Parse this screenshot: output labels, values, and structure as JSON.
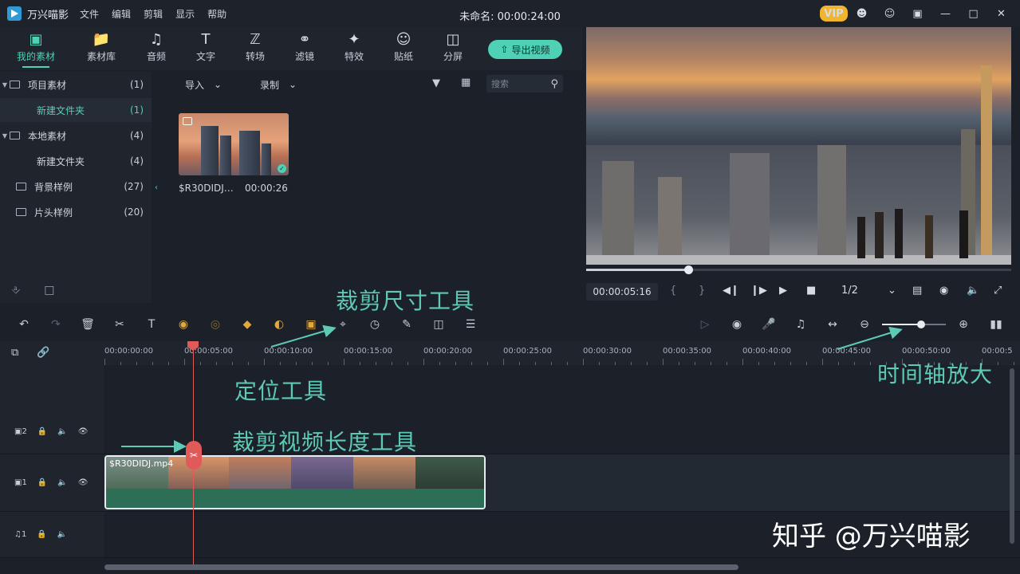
{
  "app": {
    "name": "万兴喵影",
    "menu": [
      "文件",
      "编辑",
      "剪辑",
      "显示",
      "帮助"
    ],
    "doc_title": "未命名: 00:00:24:00",
    "vip": "VIP"
  },
  "tabs": [
    {
      "label": "我的素材",
      "icon": "media-icon"
    },
    {
      "label": "素材库",
      "icon": "folder-icon"
    },
    {
      "label": "音频",
      "icon": "music-icon"
    },
    {
      "label": "文字",
      "icon": "text-icon"
    },
    {
      "label": "转场",
      "icon": "transition-icon"
    },
    {
      "label": "滤镜",
      "icon": "filter-icon"
    },
    {
      "label": "特效",
      "icon": "effects-icon"
    },
    {
      "label": "贴纸",
      "icon": "sticker-icon"
    },
    {
      "label": "分屏",
      "icon": "split-icon"
    }
  ],
  "export_label": "导出视频",
  "tree": [
    {
      "label": "项目素材",
      "count": "(1)"
    },
    {
      "label": "新建文件夹",
      "count": "(1)"
    },
    {
      "label": "本地素材",
      "count": "(4)"
    },
    {
      "label": "新建文件夹",
      "count": "(4)"
    },
    {
      "label": "背景样例",
      "count": "(27)"
    },
    {
      "label": "片头样例",
      "count": "(20)"
    }
  ],
  "media": {
    "import_label": "导入",
    "record_label": "录制",
    "search_placeholder": "搜索",
    "clip_name": "$R30DIDJ…",
    "clip_duration": "00:00:26"
  },
  "preview": {
    "timecode": "00:00:05:16",
    "ratio": "1/2",
    "progress": 0.24
  },
  "ruler": [
    "00:00:00:00",
    "00:00:05:00",
    "00:00:10:00",
    "00:00:15:00",
    "00:00:20:00",
    "00:00:25:00",
    "00:00:30:00",
    "00:00:35:00",
    "00:00:40:00",
    "00:00:45:00",
    "00:00:50:00",
    "00:00:5"
  ],
  "tracks": {
    "v2": "2",
    "v1": "1",
    "a1": "1",
    "clip_label": "$R30DIDJ.mp4"
  },
  "annotations": {
    "crop_size": "裁剪尺寸工具",
    "locate": "定位工具",
    "trim": "裁剪视频长度工具",
    "zoom": "时间轴放大"
  },
  "watermark": "知乎 @万兴喵影",
  "colors": {
    "accent": "#4fd1b6",
    "playhead": "#e05a5a",
    "annotation": "#5ec9b4"
  }
}
